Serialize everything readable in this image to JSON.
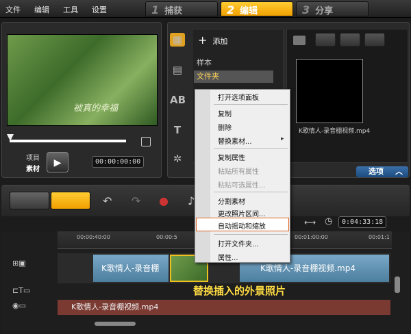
{
  "menu": {
    "file": "文件",
    "edit": "编辑",
    "tools": "工具",
    "settings": "设置"
  },
  "steps": [
    {
      "num": "1",
      "label": "捕获"
    },
    {
      "num": "2",
      "label": "编辑"
    },
    {
      "num": "3",
      "label": "分享"
    }
  ],
  "player": {
    "project_label": "项目",
    "clip_label": "素材",
    "timecode": "00:00:00:00",
    "preview_overlay": "被真的幸福"
  },
  "library": {
    "add_label": "添加",
    "folders": [
      "样本",
      "文件夹"
    ],
    "thumb_caption": "K歌情人-录音棚视频.mp4",
    "options_label": "选项"
  },
  "context_menu": {
    "items": [
      {
        "label": "打开选项面板",
        "enabled": true
      },
      {
        "label": "复制",
        "enabled": true
      },
      {
        "label": "删除",
        "enabled": true
      },
      {
        "label": "替换素材...",
        "enabled": true,
        "submenu": true
      },
      {
        "label": "复制属性",
        "enabled": true
      },
      {
        "label": "粘贴所有属性",
        "enabled": false
      },
      {
        "label": "粘贴可选属性...",
        "enabled": false
      },
      {
        "label": "分割素材",
        "enabled": true
      },
      {
        "label": "更改照片区间...",
        "enabled": true
      },
      {
        "label": "自动摇动和缩放",
        "enabled": true,
        "highlighted": true
      },
      {
        "label": "打开文件夹...",
        "enabled": true
      },
      {
        "label": "属性...",
        "enabled": true
      }
    ]
  },
  "timeline": {
    "total_time": "0:04:33:18",
    "ruler_labels": [
      "00:00:40:00",
      "00:00:5",
      "00:01:00:00",
      "00:01:1"
    ],
    "video_clip_1": "K歌情人-录音棚",
    "video_clip_2": "K歌情人-录音棚视频.mp4",
    "audio_clip": "K歌情人-录音棚视频.mp4",
    "annotation": "替换插入的外景照片"
  }
}
